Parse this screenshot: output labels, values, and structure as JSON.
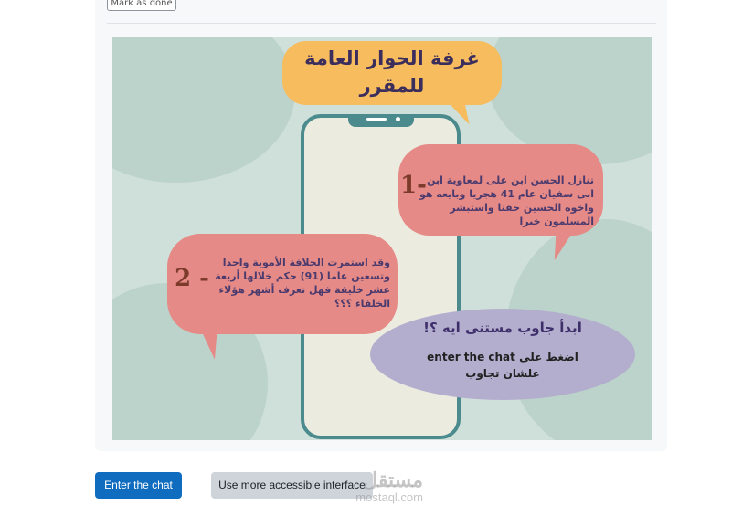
{
  "top": {
    "mark_done_label": "Mark as done"
  },
  "banner": {
    "title_line1": "غرفة الحوار العامة",
    "title_line2": "للمقرر",
    "bubble1": {
      "number": "1-",
      "text": "تنازل الحسن ابن على لمعاوية ابن ابى سفيان عام 41 هجريا وبايعه هو واخوه الحسين حقنا واستبشر المسلمون خيرا"
    },
    "bubble2": {
      "number": "2 -",
      "text": "وقد استمرت الخلافة الأموية واحدا وتسعين عاما (91) حكم خلالها أربعة عشر خليفة فهل تعرف أشهر هؤلاء الخلفاء ؟؟؟"
    },
    "bubble3": {
      "title": "ابدأ جاوب مستنى ايه ؟!",
      "line1": "اضغط على enter the chat",
      "line2": "علشان تجاوب"
    }
  },
  "actions": {
    "enter_chat_label": "Enter the chat",
    "accessible_label": "Use more accessible interface"
  },
  "watermark": {
    "arabic": "مستقل",
    "latin": "mostaql.com"
  },
  "colors": {
    "primary": "#0f6cbf",
    "secondary": "#ced4da",
    "bubble_title": "#f6bc5e",
    "bubble_red": "#e58a86",
    "bubble_purple": "#b3aece",
    "phone_frame": "#4b8b8d"
  }
}
